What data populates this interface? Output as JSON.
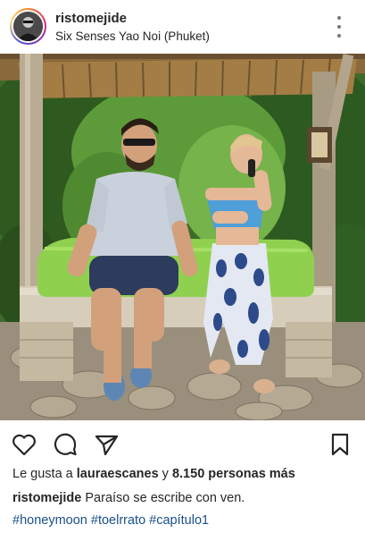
{
  "post": {
    "username": "ristomejide",
    "location": "Six Senses Yao Noi (Phuket)",
    "more_icon": "more-vertical-icon"
  },
  "image": {
    "description_icon": "photo",
    "accent_cushion": "#8fd14f"
  },
  "actions": {
    "like_icon": "heart-icon",
    "comment_icon": "comment-icon",
    "share_icon": "send-icon",
    "save_icon": "bookmark-icon"
  },
  "likes": {
    "prefix": "Le gusta a ",
    "user": "lauraescanes",
    "middle": " y ",
    "count_text": "8.150 personas más"
  },
  "caption": {
    "username": "ristomejide",
    "text": "Paraíso se escribe con ven."
  },
  "hashtags": [
    "#honeymoon",
    "#toelrrato",
    "#capítulo1"
  ],
  "colors": {
    "text": "#262626",
    "hashtag": "#1a4f8b"
  }
}
